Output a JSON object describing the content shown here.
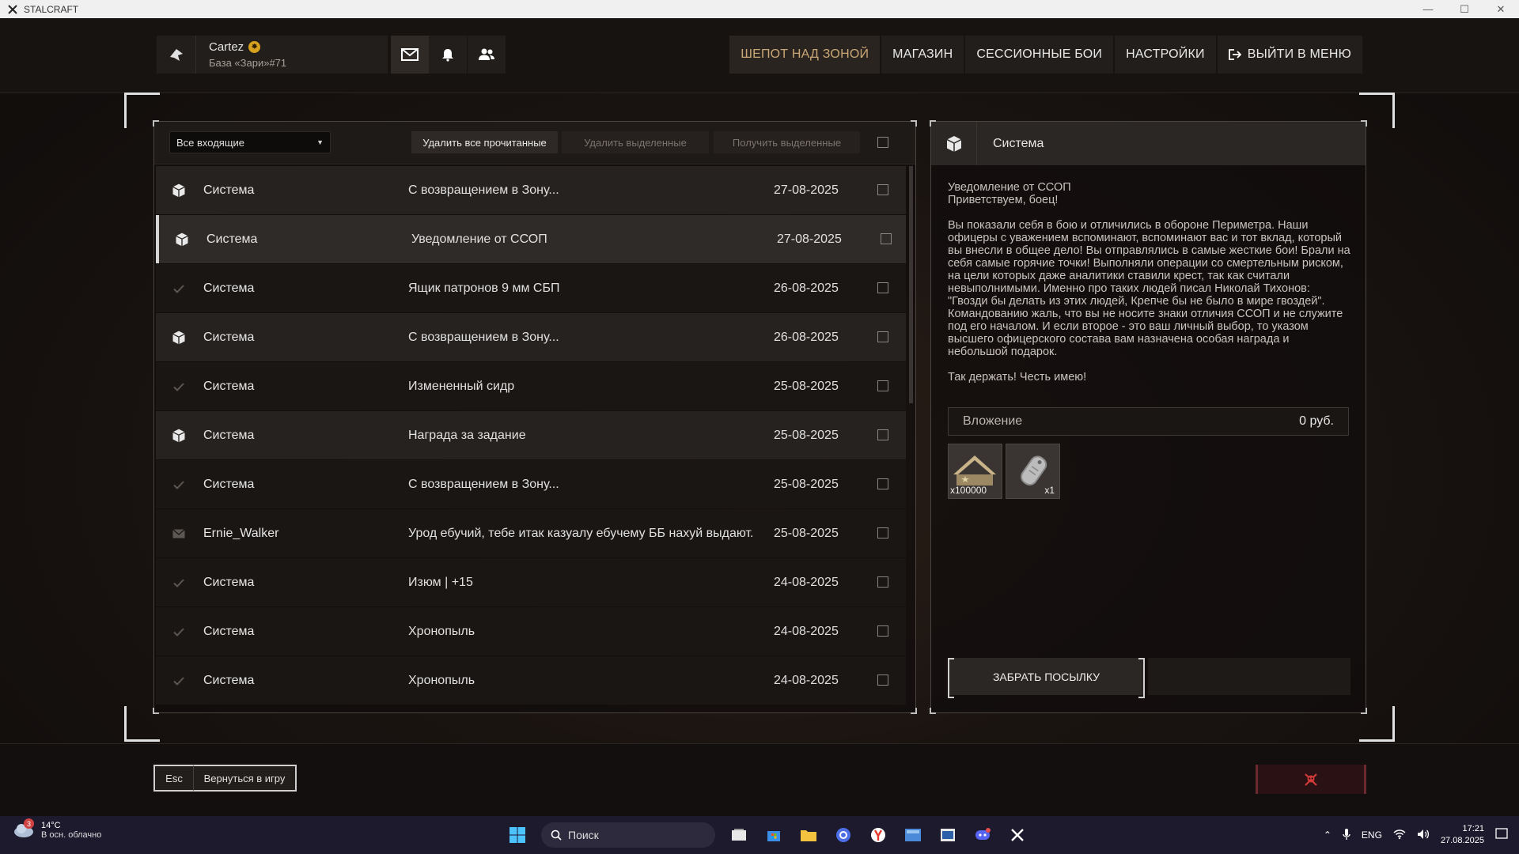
{
  "window": {
    "title": "STALCRAFT"
  },
  "profile": {
    "nickname": "Cartez",
    "base": "База «Зари»#71"
  },
  "nav": [
    {
      "label": "ШЕПОТ НАД ЗОНОЙ"
    },
    {
      "label": "МАГАЗИН"
    },
    {
      "label": "СЕССИОННЫЕ БОИ"
    },
    {
      "label": "НАСТРОЙКИ"
    },
    {
      "label": "ВЫЙТИ В МЕНЮ"
    }
  ],
  "toolbar": {
    "filter": "Все входящие",
    "delete_read": "Удалить все прочитанные",
    "delete_selected": "Удалить выделенные",
    "receive_selected": "Получить выделенные"
  },
  "mails": [
    {
      "sender": "Система",
      "subject": "С возвращением в Зону...",
      "date": "27-08-2025",
      "icon": "package-icon",
      "state": "unread"
    },
    {
      "sender": "Система",
      "subject": "Уведомление от ССОП",
      "date": "27-08-2025",
      "icon": "package-icon",
      "state": "selected"
    },
    {
      "sender": "Система",
      "subject": "Ящик патронов 9 мм СБП",
      "date": "26-08-2025",
      "icon": "check-icon",
      "state": "read"
    },
    {
      "sender": "Система",
      "subject": "С возвращением в Зону...",
      "date": "26-08-2025",
      "icon": "package-icon",
      "state": "unread"
    },
    {
      "sender": "Система",
      "subject": "Измененный сидр",
      "date": "25-08-2025",
      "icon": "check-icon",
      "state": "read"
    },
    {
      "sender": "Система",
      "subject": "Награда за задание",
      "date": "25-08-2025",
      "icon": "package-icon",
      "state": "unread"
    },
    {
      "sender": "Система",
      "subject": "С возвращением в Зону...",
      "date": "25-08-2025",
      "icon": "check-icon",
      "state": "read"
    },
    {
      "sender": "Ernie_Walker",
      "subject": "Урод ебучий, тебе итак казуалу ебучему ББ нахуй выдают.",
      "date": "25-08-2025",
      "icon": "envelope-icon",
      "state": "read"
    },
    {
      "sender": "Система",
      "subject": "Изюм | +15",
      "date": "24-08-2025",
      "icon": "check-icon",
      "state": "read"
    },
    {
      "sender": "Система",
      "subject": "Хронопыль",
      "date": "24-08-2025",
      "icon": "check-icon",
      "state": "read"
    },
    {
      "sender": "Система",
      "subject": "Хронопыль",
      "date": "24-08-2025",
      "icon": "check-icon",
      "state": "read"
    }
  ],
  "detail": {
    "sender": "Система",
    "heading": "Уведомление от ССОП",
    "greeting": "Приветствуем, боец!",
    "body": "Вы показали себя в бою и отличились в обороне Периметра. Наши офицеры с уважением вспоминают, вспоминают вас и тот вклад, который вы внесли в общее дело! Вы отправлялись в самые жесткие бои! Брали на себя самые горячие точки! Выполняли операции со смертельным риском, на цели которых даже аналитики ставили крест, так как считали невыполнимыми. Именно про таких людей писал Николай Тихонов: \"Гвозди бы делать из этих людей, Крепче бы не было в мире гвоздей\". Командованию жаль, что вы не носите знаки отличия ССОП и не служите под его началом. И если второе - это ваш личный выбор, то указом высшего офицерского состава вам назначена особая награда и небольшой подарок.",
    "closing": "Так держать! Честь имею!",
    "attachment_label": "Вложение",
    "attachment_cost": "0 руб.",
    "items": [
      {
        "name": "reputation-item",
        "qty": "x100000"
      },
      {
        "name": "token-item",
        "qty": "x1"
      }
    ],
    "claim_label": "ЗАБРАТЬ ПОСЫЛКУ"
  },
  "bottom": {
    "esc_key": "Esc",
    "return_label": "Вернуться в игру"
  },
  "taskbar": {
    "weather_temp": "14°C",
    "weather_desc": "В осн. облачно",
    "weather_badge": "3",
    "search_label": "Поиск",
    "language": "ENG",
    "time": "17:21",
    "date": "27.08.2025"
  },
  "colors": {
    "accent_nav": "#c9a876",
    "report": "#d23a3a"
  }
}
